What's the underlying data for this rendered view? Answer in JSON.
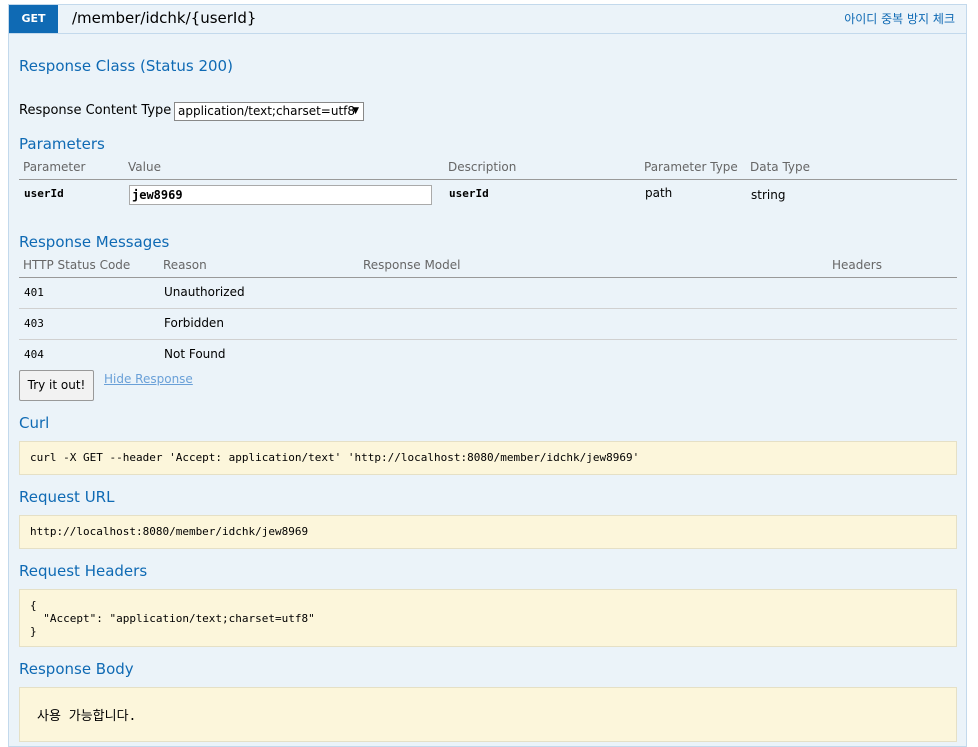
{
  "operation": {
    "method": "GET",
    "path": "/member/idchk/{userId}",
    "summary": "아이디 중복 방지 체크"
  },
  "response_class": {
    "title": "Response Class (Status 200)"
  },
  "response_content_type": {
    "label": "Response Content Type",
    "selected": "application/text;charset=utf8"
  },
  "parameters": {
    "title": "Parameters",
    "headers": [
      "Parameter",
      "Value",
      "Description",
      "Parameter Type",
      "Data Type"
    ],
    "rows": [
      {
        "name": "userId",
        "value": "jew8969",
        "description": "userId",
        "param_type": "path",
        "data_type": "string"
      }
    ]
  },
  "response_messages": {
    "title": "Response Messages",
    "headers": [
      "HTTP Status Code",
      "Reason",
      "Response Model",
      "Headers"
    ],
    "rows": [
      {
        "code": "401",
        "reason": "Unauthorized"
      },
      {
        "code": "403",
        "reason": "Forbidden"
      },
      {
        "code": "404",
        "reason": "Not Found"
      }
    ]
  },
  "actions": {
    "try_label": "Try it out!",
    "hide_label": "Hide Response"
  },
  "curl": {
    "title": "Curl",
    "text": "curl -X GET --header 'Accept: application/text' 'http://localhost:8080/member/idchk/jew8969'"
  },
  "request_url": {
    "title": "Request URL",
    "text": "http://localhost:8080/member/idchk/jew8969"
  },
  "request_headers": {
    "title": "Request Headers",
    "text": "{\n  \"Accept\": \"application/text;charset=utf8\"\n}"
  },
  "response_body": {
    "title": "Response Body",
    "text": "사용 가능합니다."
  }
}
